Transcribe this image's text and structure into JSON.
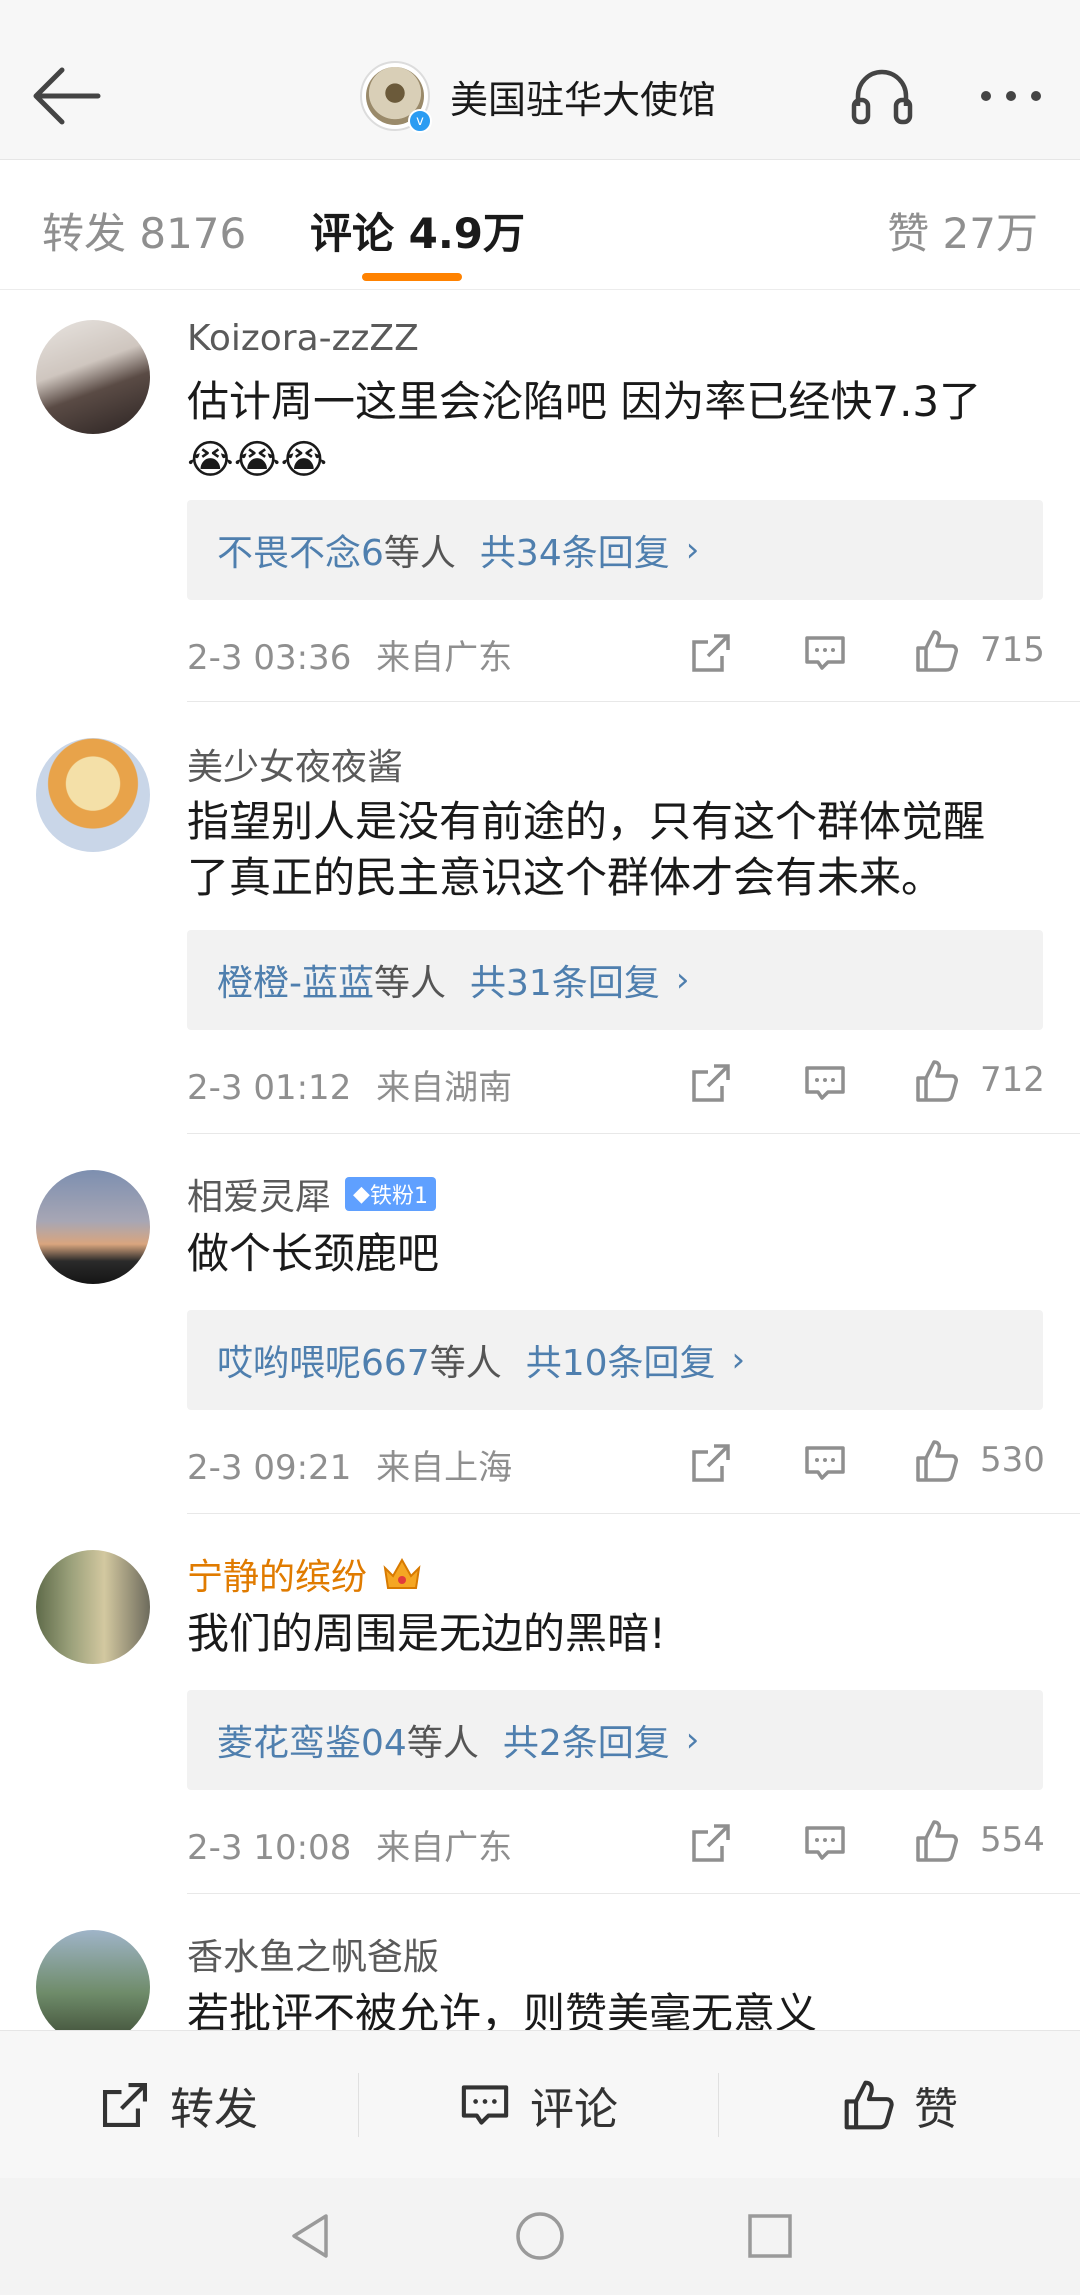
{
  "header": {
    "title": "美国驻华大使馆"
  },
  "tabs": {
    "repost": "转发 8176",
    "comment": "评论 4.9万",
    "like": "赞 27万"
  },
  "comments": [
    {
      "user": "Koizora-zzZZ",
      "text": "估计周一这里会沦陷吧 因为率已经快7.3了",
      "emoji": "😭😭😭",
      "reply_names": "不畏不念6",
      "reply_suffix": "等人",
      "reply_total": "共34条回复",
      "time": "2-3 03:36",
      "location": "来自广东",
      "likes": "715"
    },
    {
      "user": "美少女夜夜酱",
      "text_line1": "指望别人是没有前途的，只有这个群体觉醒",
      "text_line2": "了真正的民主意识这个群体才会有未来。",
      "reply_names": "橙橙-蓝蓝",
      "reply_suffix": "等人",
      "reply_total": "共31条回复",
      "time": "2-3 01:12",
      "location": "来自湖南",
      "likes": "712"
    },
    {
      "user": "相爱灵犀",
      "badge": "铁粉1",
      "text": "做个长颈鹿吧",
      "reply_names": "哎哟喂呢667",
      "reply_suffix": "等人",
      "reply_total": "共10条回复",
      "time": "2-3 09:21",
      "location": "来自上海",
      "likes": "530"
    },
    {
      "user": "宁静的缤纷",
      "text": "我们的周围是无边的黑暗!",
      "reply_names": "菱花鸾鉴04",
      "reply_suffix": "等人",
      "reply_total": "共2条回复",
      "time": "2-3 10:08",
      "location": "来自广东",
      "likes": "554"
    },
    {
      "user": "香水鱼之帆爸版",
      "text": "若批评不被允许，则赞美毫无意义"
    }
  ],
  "bottom_bar": {
    "repost": "转发",
    "comment": "评论",
    "like": "赞"
  },
  "icons": {
    "back": "back-arrow-icon",
    "headset": "headphones-icon",
    "more": "more-dots-icon",
    "share": "share-icon",
    "comment": "comment-icon",
    "like": "thumbs-up-icon"
  },
  "colors": {
    "accent": "#ff8200",
    "link": "#4f7fae",
    "vip_name": "#e07b00"
  }
}
